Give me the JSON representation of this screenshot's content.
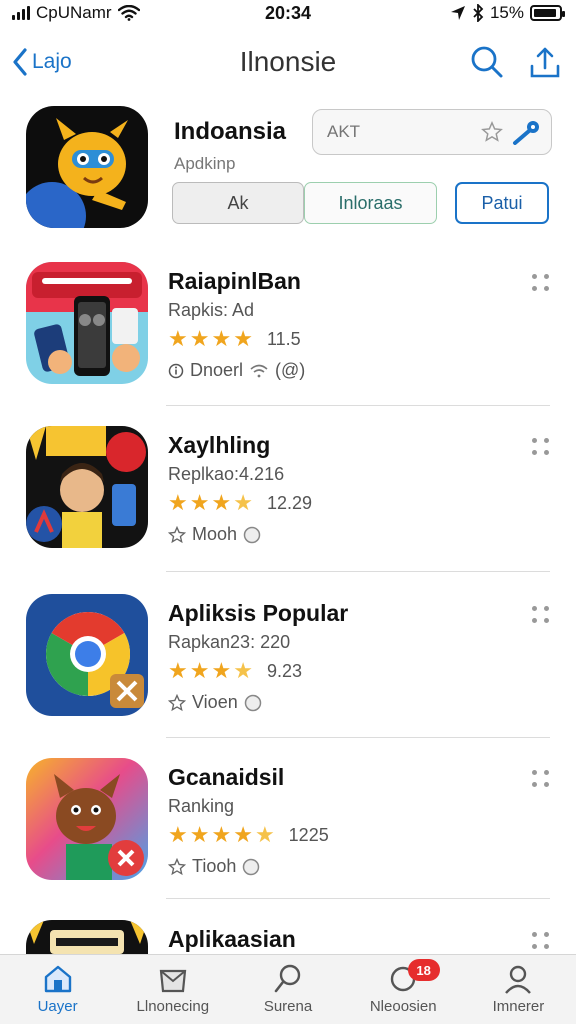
{
  "status_bar": {
    "carrier": "CpUNamr",
    "time": "20:34",
    "battery": "15%",
    "battery_level": 0.9
  },
  "nav": {
    "back_label": "Lajo",
    "title": "Ilnonsie"
  },
  "featured": {
    "name": "Indoansia",
    "subtitle": "Apdkinp",
    "search_placeholder": "AKT",
    "segments": [
      "Ak",
      "Inloraas",
      "Patui"
    ]
  },
  "apps": [
    {
      "name": "RaiapinlBan",
      "subtitle": "Rapkis: Ad",
      "stars": 4,
      "score": "11.5",
      "meta": "Dnoerl",
      "meta_extra": "(@)"
    },
    {
      "name": "Xaylhling",
      "subtitle": "Replkao:4.216",
      "stars": 3.5,
      "score": "12.29",
      "meta": "Mooh",
      "meta_extra": ""
    },
    {
      "name": "Apliksis Popular",
      "subtitle": "Rapkan23: 220",
      "stars": 3.5,
      "score": "9.23",
      "meta": "Vioen",
      "meta_extra": ""
    },
    {
      "name": "Gcanaidsil",
      "subtitle": "Ranking",
      "stars": 4.5,
      "score": "1225",
      "meta": "Tiooh",
      "meta_extra": ""
    },
    {
      "name": "Aplikaasian",
      "subtitle": "",
      "stars": 0,
      "score": "",
      "meta": "",
      "meta_extra": ""
    }
  ],
  "tab_bar": {
    "tabs": [
      {
        "label": "Uayer",
        "icon": "store-icon",
        "active": true
      },
      {
        "label": "Llnonecing",
        "icon": "folder-icon",
        "active": false
      },
      {
        "label": "Surena",
        "icon": "search-icon",
        "active": false
      },
      {
        "label": "Nleoosien",
        "icon": "bell-icon",
        "active": false,
        "badge": "18"
      },
      {
        "label": "Imnerer",
        "icon": "person-icon",
        "active": false
      }
    ]
  },
  "colors": {
    "accent": "#1a73c8",
    "star": "#f0a51e",
    "badge": "#e62d2d"
  }
}
